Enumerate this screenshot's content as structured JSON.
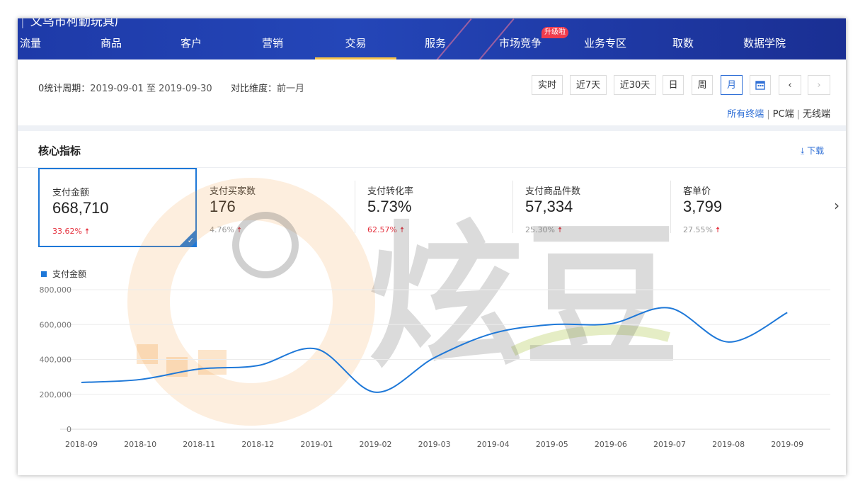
{
  "header": {
    "brand": "义乌市柯勤玩具厂",
    "badge": "升级啦",
    "nav": [
      {
        "label": "流量",
        "active": false
      },
      {
        "label": "商品",
        "active": false
      },
      {
        "label": "客户",
        "active": false
      },
      {
        "label": "营销",
        "active": false
      },
      {
        "label": "交易",
        "active": true
      },
      {
        "label": "服务",
        "active": false
      },
      {
        "label": "市场竞争",
        "active": false
      },
      {
        "label": "业务专区",
        "active": false
      },
      {
        "label": "取数",
        "active": false
      },
      {
        "label": "数据学院",
        "active": false
      }
    ]
  },
  "filters": {
    "period_label": "0统计周期：",
    "period_value": "2019-09-01 至 2019-09-30",
    "compare_label": "对比维度：",
    "compare_value": "前一月",
    "buttons": [
      "实时",
      "近7天",
      "近30天",
      "日",
      "周",
      "月"
    ],
    "active_button": "月",
    "calendar_icon": "calendar-icon",
    "prev_icon": "chevron-left-icon",
    "next_icon": "chevron-right-icon",
    "terminals": [
      "所有终端",
      "PC端",
      "无线端"
    ],
    "active_terminal": "所有终端"
  },
  "section": {
    "title": "核心指标",
    "download": "下载"
  },
  "metrics": [
    {
      "label": "支付金额",
      "value": "668,710",
      "change": "33.62%",
      "change_color": "#e5323f",
      "selected": true
    },
    {
      "label": "支付买家数",
      "value": "176",
      "change": "4.76%",
      "change_color": "#999999",
      "selected": false
    },
    {
      "label": "支付转化率",
      "value": "5.73%",
      "change": "62.57%",
      "change_color": "#e5323f",
      "selected": false
    },
    {
      "label": "支付商品件数",
      "value": "57,334",
      "change": "25.30%",
      "change_color": "#999999",
      "selected": false
    },
    {
      "label": "客单价",
      "value": "3,799",
      "change": "27.55%",
      "change_color": "#999999",
      "selected": false
    }
  ],
  "watermark": "炫豆",
  "chart_data": {
    "type": "line",
    "legend": "支付金额",
    "x": [
      "2018-09",
      "2018-10",
      "2018-11",
      "2018-12",
      "2019-01",
      "2019-02",
      "2019-03",
      "2019-04",
      "2019-05",
      "2019-06",
      "2019-07",
      "2019-08",
      "2019-09"
    ],
    "series": [
      {
        "name": "支付金额",
        "color": "#1e78d8",
        "values": [
          268000,
          285000,
          345000,
          365000,
          460000,
          212000,
          410000,
          550000,
          600000,
          605000,
          695000,
          500000,
          668710
        ]
      }
    ],
    "y_ticks": [
      "0",
      "200,000",
      "400,000",
      "600,000",
      "800,000"
    ],
    "ylim": [
      0,
      800000
    ],
    "grid": true
  }
}
